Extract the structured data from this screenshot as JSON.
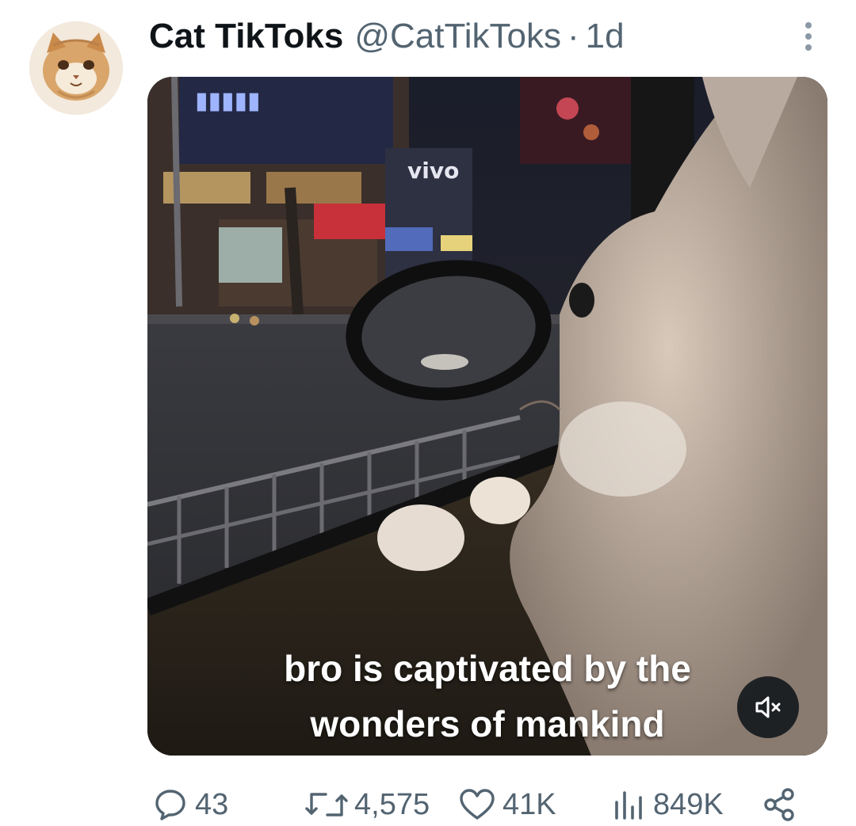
{
  "tweet": {
    "display_name": "Cat TikToks",
    "handle": "@CatTikToks",
    "separator": "·",
    "time": "1d",
    "media": {
      "caption_line1": "bro is captivated by the",
      "caption_line2": "wonders of mankind",
      "sign_text": "vivo"
    },
    "actions": {
      "replies": "43",
      "retweets": "4,575",
      "likes": "41K",
      "views": "849K"
    }
  },
  "icons": {
    "more": "more-dots-icon",
    "mute": "speaker-muted-icon",
    "reply": "speech-bubble-icon",
    "retweet": "retweet-arrows-icon",
    "like": "heart-icon",
    "views": "bar-chart-icon",
    "share": "share-nodes-icon"
  },
  "colors": {
    "text_primary": "#0f1419",
    "text_secondary": "#536471"
  }
}
